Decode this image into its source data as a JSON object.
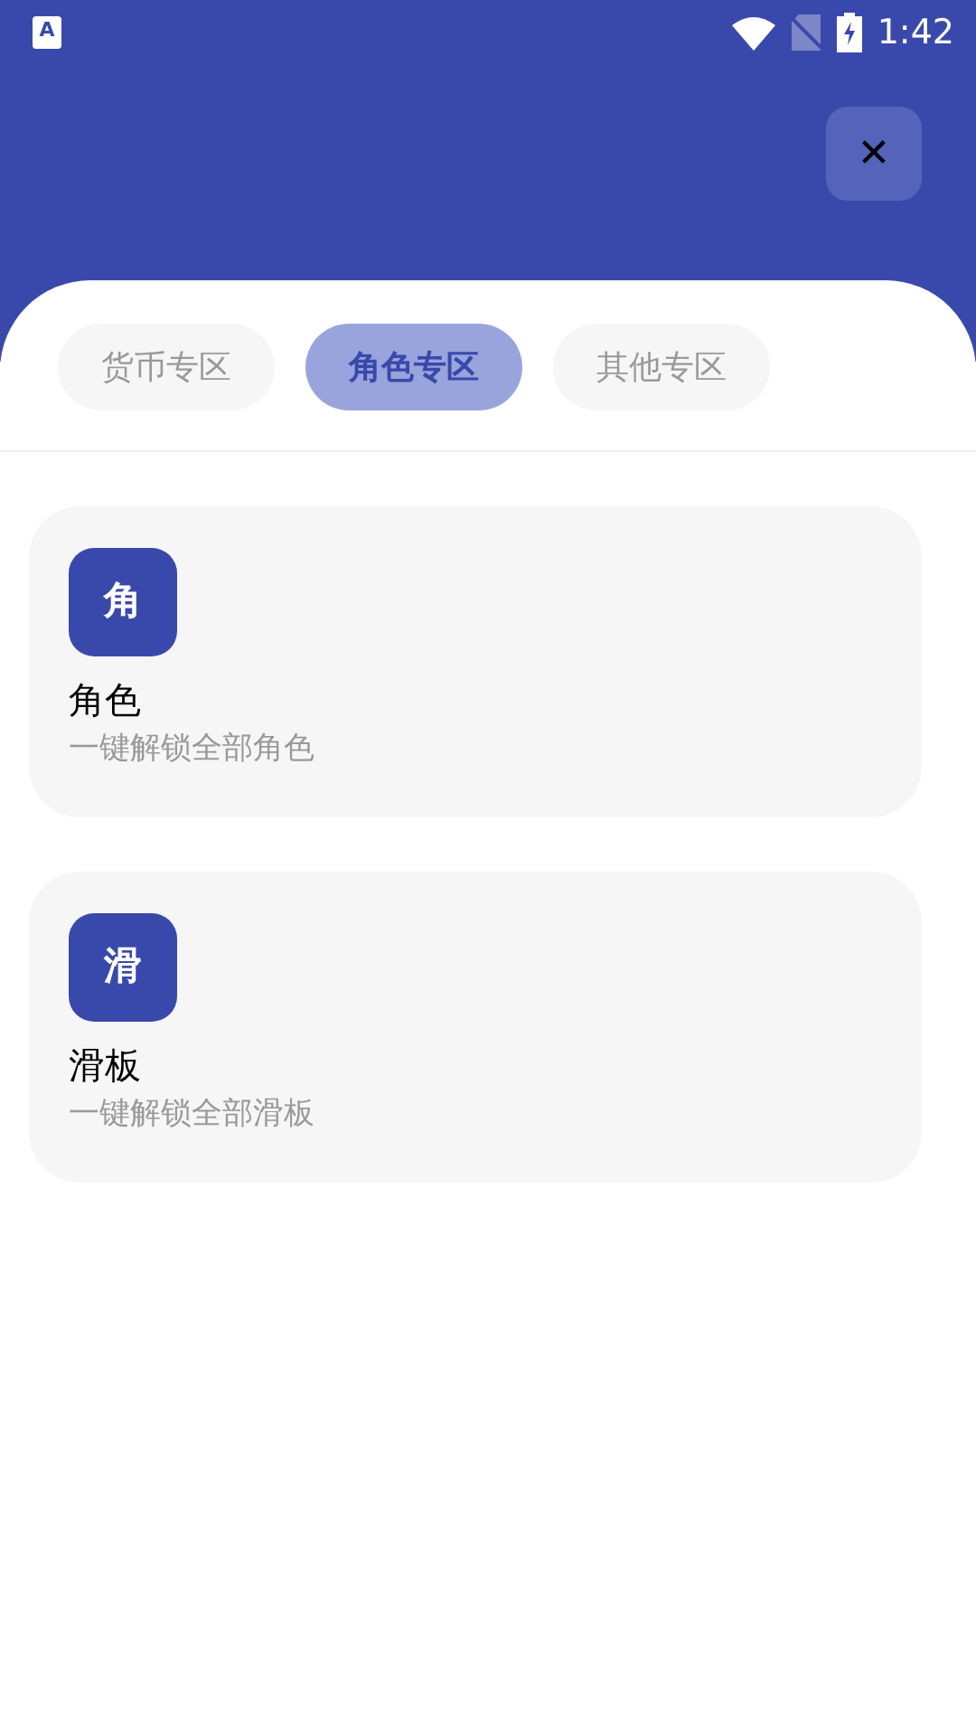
{
  "status_bar": {
    "time": "1:42",
    "app_icon_letter": "A"
  },
  "close_button": {
    "label": "✕"
  },
  "tabs": [
    {
      "label": "货币专区",
      "selected": false
    },
    {
      "label": "角色专区",
      "selected": true
    },
    {
      "label": "其他专区",
      "selected": false
    }
  ],
  "items": [
    {
      "icon_char": "角",
      "title": "角色",
      "subtitle": "一键解锁全部角色"
    },
    {
      "icon_char": "滑",
      "title": "滑板",
      "subtitle": "一键解锁全部滑板"
    }
  ]
}
